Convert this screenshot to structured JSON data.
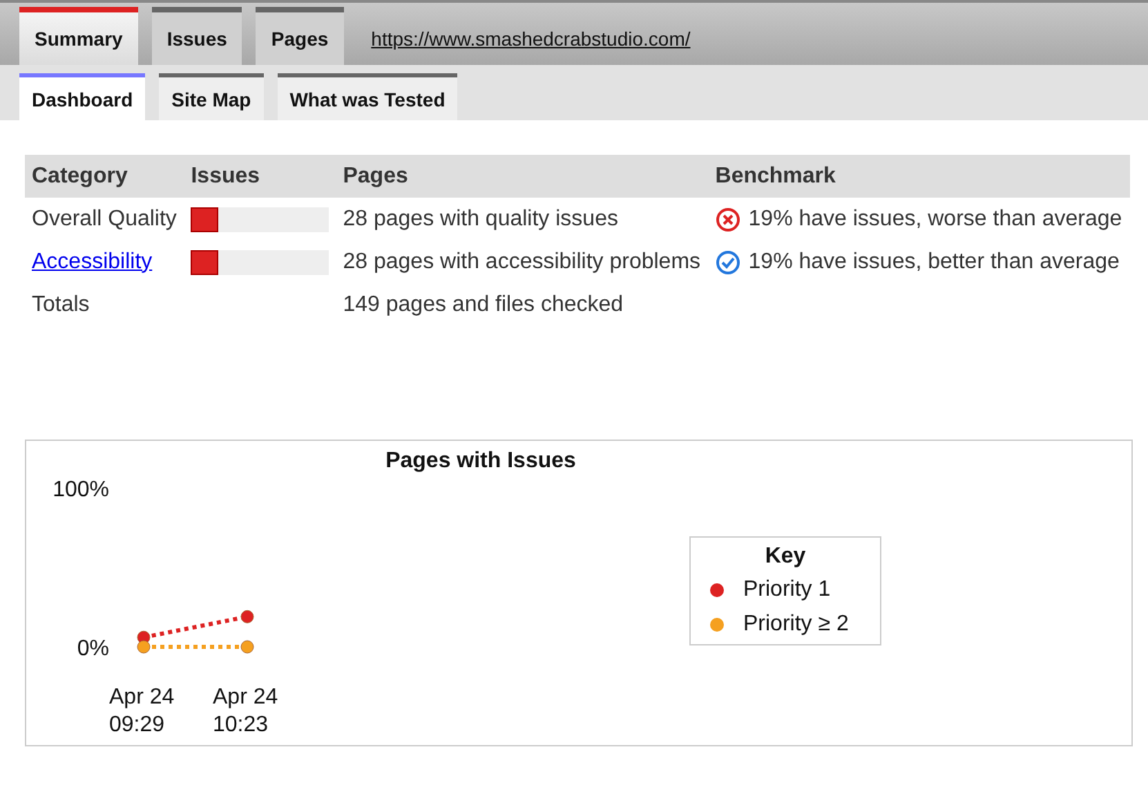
{
  "tabs": [
    {
      "label": "Summary",
      "selected": true
    },
    {
      "label": "Issues",
      "selected": false
    },
    {
      "label": "Pages",
      "selected": false
    }
  ],
  "site_url": "https://www.smashedcrabstudio.com/",
  "subtabs": [
    {
      "label": "Dashboard",
      "selected": true
    },
    {
      "label": "Site Map",
      "selected": false
    },
    {
      "label": "What was Tested",
      "selected": false
    }
  ],
  "table": {
    "columns": [
      "Category",
      "Issues",
      "Pages",
      "Benchmark"
    ],
    "rows": [
      {
        "category": "Overall Quality",
        "link": false,
        "level": 0.2,
        "pages": "28 pages with quality issues",
        "benchmark": {
          "kind": "worse",
          "text": "19% have issues, worse than average"
        }
      },
      {
        "category": "Accessibility",
        "link": true,
        "level": 0.2,
        "pages": "28 pages with accessibility problems",
        "benchmark": {
          "kind": "better",
          "text": "19% have issues, better than average"
        }
      },
      {
        "category": "Totals",
        "link": false,
        "pages": "149 pages and files checked"
      }
    ]
  },
  "chart": {
    "chart_data": {
      "type": "line",
      "title": "Pages with Issues",
      "categories": [
        "Apr 24 09:29",
        "Apr 24 10:23"
      ],
      "yticks": [
        {
          "value": 0,
          "label": "0%"
        },
        {
          "value": 100,
          "label": "100%"
        }
      ],
      "ylim": [
        0,
        100
      ],
      "series": [
        {
          "name": "Priority 1",
          "color": "#dd2222",
          "line_style": "dotted",
          "marker": "circle",
          "values": [
            6,
            19
          ]
        },
        {
          "name": "Priority ≥ 2",
          "color": "#f5a020",
          "line_style": "dotted",
          "marker": "circle",
          "values": [
            0,
            0
          ]
        }
      ]
    },
    "legend_title": "Key"
  }
}
